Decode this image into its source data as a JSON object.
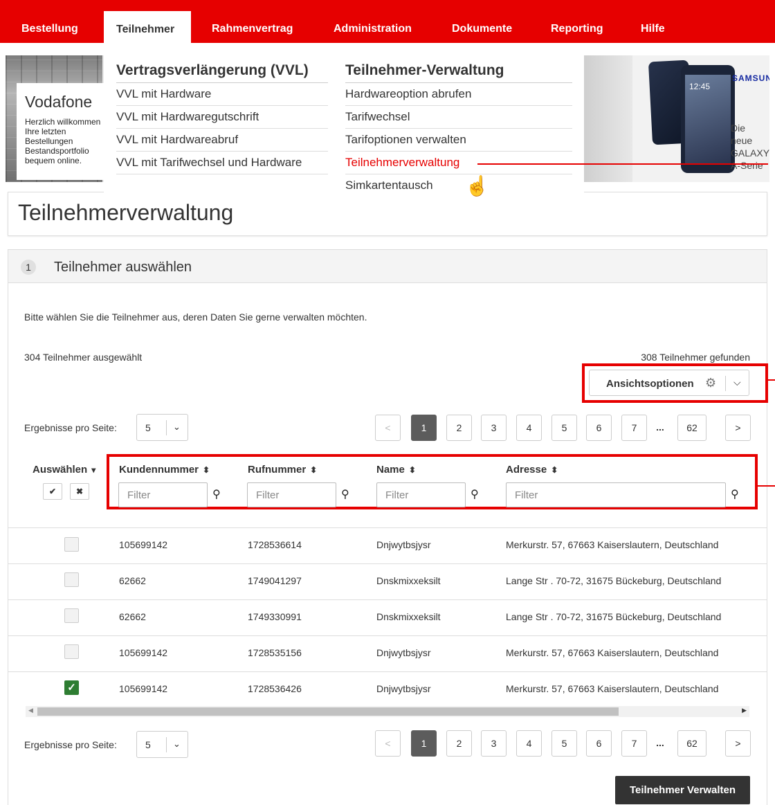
{
  "nav": {
    "items": [
      "Bestellung",
      "Teilnehmer",
      "Rahmenvertrag",
      "Administration",
      "Dokumente",
      "Reporting",
      "Hilfe"
    ]
  },
  "hero": {
    "brand": "Vodafone",
    "text": "Herzlich willkommen Ihre letzten Bestellungen Bestandsportfolio bequem online.",
    "samsung": "SAMSUNG",
    "galaxy": "Die neue GALAXY A-Serie",
    "phone_time": "12:45"
  },
  "dropdown": {
    "col1": {
      "head": "Vertragsverlängerung (VVL)",
      "links": [
        "VVL mit Hardware",
        "VVL mit Hardwaregutschrift",
        "VVL mit Hardwareabruf",
        "VVL mit Tarifwechsel und Hardware"
      ]
    },
    "col2": {
      "head": "Teilnehmer-Verwaltung",
      "links": [
        "Hardwareoption abrufen",
        "Tarifwechsel",
        "Tarifoptionen verwalten",
        "Teilnehmerverwaltung",
        "Simkartentausch"
      ]
    }
  },
  "page": {
    "title": "Teilnehmerverwaltung",
    "step_number": "1",
    "step_title": "Teilnehmer auswählen",
    "intro": "Bitte wählen Sie die Teilnehmer aus, deren Daten Sie gerne verwalten möchten.",
    "selected": "304 Teilnehmer ausgewählt",
    "found": "308 Teilnehmer gefunden",
    "view_options": "Ansichtsoptionen",
    "per_page_label": "Ergebnisse pro Seite:",
    "per_page_value": "5",
    "submit": "Teilnehmer Verwalten"
  },
  "pagination": {
    "prev": "<",
    "next": ">",
    "pages": [
      "1",
      "2",
      "3",
      "4",
      "5",
      "6",
      "7"
    ],
    "dots": "...",
    "last": "62",
    "current": "1"
  },
  "table": {
    "select_header": "Auswählen",
    "select_all": "✔",
    "select_none": "✖",
    "columns": [
      "Kundennummer",
      "Rufnummer",
      "Name",
      "Adresse"
    ],
    "filter_placeholder": "Filter",
    "rows": [
      {
        "checked": false,
        "kundennummer": "105699142",
        "rufnummer": "1728536614",
        "name": "Dnjwytbsjysr",
        "adresse": "Merkurstr. 57, 67663 Kaiserslautern, Deutschland"
      },
      {
        "checked": false,
        "kundennummer": "62662",
        "rufnummer": "1749041297",
        "name": "Dnskmixxeksilt",
        "adresse": "Lange Str . 70-72, 31675 Bückeburg, Deutschland"
      },
      {
        "checked": false,
        "kundennummer": "62662",
        "rufnummer": "1749330991",
        "name": "Dnskmixxeksilt",
        "adresse": "Lange Str . 70-72, 31675 Bückeburg, Deutschland"
      },
      {
        "checked": false,
        "kundennummer": "105699142",
        "rufnummer": "1728535156",
        "name": "Dnjwytbsjysr",
        "adresse": "Merkurstr. 57, 67663 Kaiserslautern, Deutschland"
      },
      {
        "checked": true,
        "kundennummer": "105699142",
        "rufnummer": "1728536426",
        "name": "Dnjwytbsjysr",
        "adresse": "Merkurstr. 57, 67663 Kaiserslautern, Deutschland"
      }
    ]
  },
  "colors": {
    "brand_red": "#e60000",
    "dark_button": "#333333",
    "checked_green": "#2e7d32"
  }
}
